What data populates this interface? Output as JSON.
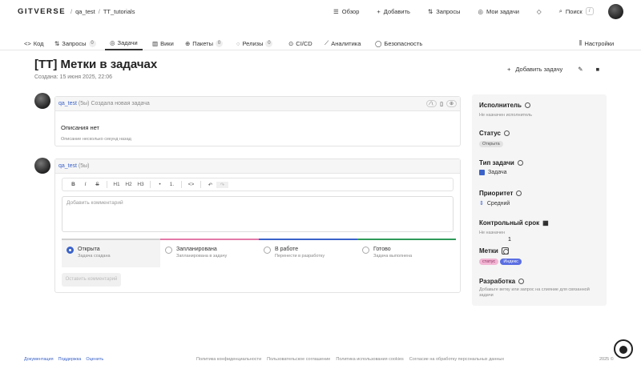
{
  "header": {
    "logo": "GITVERSE",
    "breadcrumb": [
      "qa_test",
      "TT_tutorials"
    ],
    "nav": [
      {
        "label": "Обзор",
        "icon": "overview-icon"
      },
      {
        "label": "Добавить",
        "icon": "plus-icon"
      },
      {
        "label": "Запросы",
        "icon": "pull-request-icon"
      },
      {
        "label": "Мои задачи",
        "icon": "task-icon"
      }
    ],
    "search_label": "Поиск",
    "search_kbd": "/"
  },
  "tabs": [
    {
      "label": "Код",
      "count": ""
    },
    {
      "label": "Запросы",
      "count": "0"
    },
    {
      "label": "Задачи",
      "count": "",
      "active": true
    },
    {
      "label": "Вики",
      "count": ""
    },
    {
      "label": "Пакеты",
      "count": "0"
    },
    {
      "label": "Релизы",
      "count": "0"
    },
    {
      "label": "CI/CD",
      "count": ""
    },
    {
      "label": "Аналитика",
      "count": ""
    },
    {
      "label": "Безопасность",
      "count": ""
    }
  ],
  "settings_label": "Настройки",
  "issue": {
    "title": "[TT] Метки в задачах",
    "created": "Создана: 15 июня 2025, 22:06",
    "add_task_label": "Добавить задачу"
  },
  "first_comment": {
    "user": "qa_test",
    "time": "(5ы)",
    "action": "Создала новая задача",
    "heading": "Описания нет",
    "text": "Описание несколько секунд назад"
  },
  "new_comment": {
    "user": "qa_test",
    "time": "(5ы)",
    "toolbar": [
      "B",
      "I",
      "S",
      "H1",
      "H2",
      "H3",
      "•",
      "1.",
      "<>",
      "↶",
      "↷"
    ],
    "placeholder": "Добавить комментарий",
    "submit_label": "Оставить комментарий",
    "statuses": [
      {
        "label": "Открыта",
        "desc": "Задача создана",
        "color": "#d0d0d0",
        "selected": true
      },
      {
        "label": "Запланирована",
        "desc": "Запланирована в задачу",
        "color": "#e37aa8",
        "selected": false
      },
      {
        "label": "В работе",
        "desc": "Перенести в разработку",
        "color": "#3a62c9",
        "selected": false
      },
      {
        "label": "Готово",
        "desc": "Задача выполнена",
        "color": "#2f9a5a",
        "selected": false
      }
    ]
  },
  "sidebar": {
    "assignee": {
      "title": "Исполнитель",
      "value": "Не назначен исполнитель"
    },
    "status": {
      "title": "Статус",
      "value": "Открыта"
    },
    "type": {
      "title": "Тип задачи",
      "value": "Задача"
    },
    "priority": {
      "title": "Приоритет",
      "value": "Средний"
    },
    "deadline": {
      "title": "Контрольный срок",
      "value": "Не назначен"
    },
    "labels": {
      "title": "Метки",
      "tags": [
        "статус",
        "Индекс"
      ]
    },
    "dev": {
      "title": "Разработка",
      "value": "Добавьте ветку или запрос на слияние для связанной задачи"
    }
  },
  "marker_number": "1",
  "footer": {
    "left_links": [
      "Документация",
      "Поддержка",
      "Оценить"
    ],
    "center_links": [
      "Политика конфиденциальности",
      "Пользовательское соглашение",
      "Политика использования cookies",
      "Согласие на обработку персональных данных"
    ],
    "copyright": "2025 ©"
  }
}
